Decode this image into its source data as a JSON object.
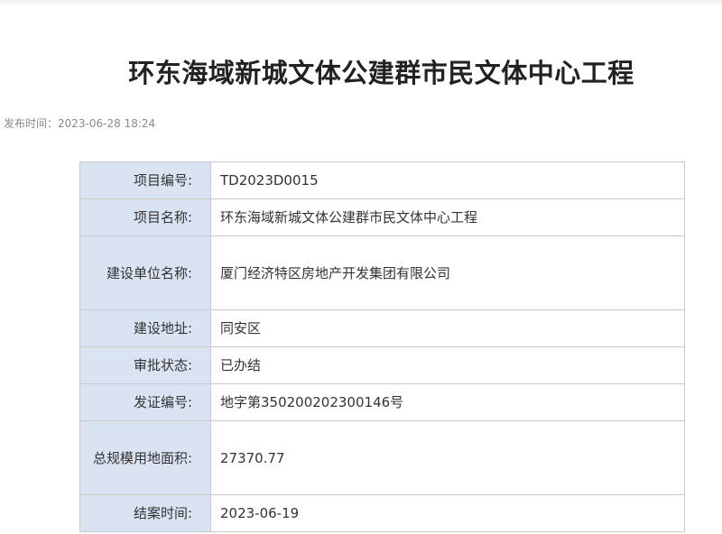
{
  "article": {
    "title": "环东海域新城文体公建群市民文体中心工程",
    "publish_label": "发布时间：",
    "publish_time": "2023-06-28 18:24"
  },
  "table": {
    "rows": [
      {
        "label": "项目编号:",
        "value": "TD2023D0015"
      },
      {
        "label": "项目名称:",
        "value": "环东海域新城文体公建群市民文体中心工程"
      },
      {
        "label": "建设单位名称:",
        "value": "厦门经济特区房地产开发集团有限公司"
      },
      {
        "label": "建设地址:",
        "value": "同安区"
      },
      {
        "label": "审批状态:",
        "value": "已办结"
      },
      {
        "label": "发证编号:",
        "value": "地字第350200202300146号"
      },
      {
        "label": "总规模用地面积:",
        "value": "27370.77"
      },
      {
        "label": "结案时间:",
        "value": "2023-06-19"
      }
    ]
  }
}
